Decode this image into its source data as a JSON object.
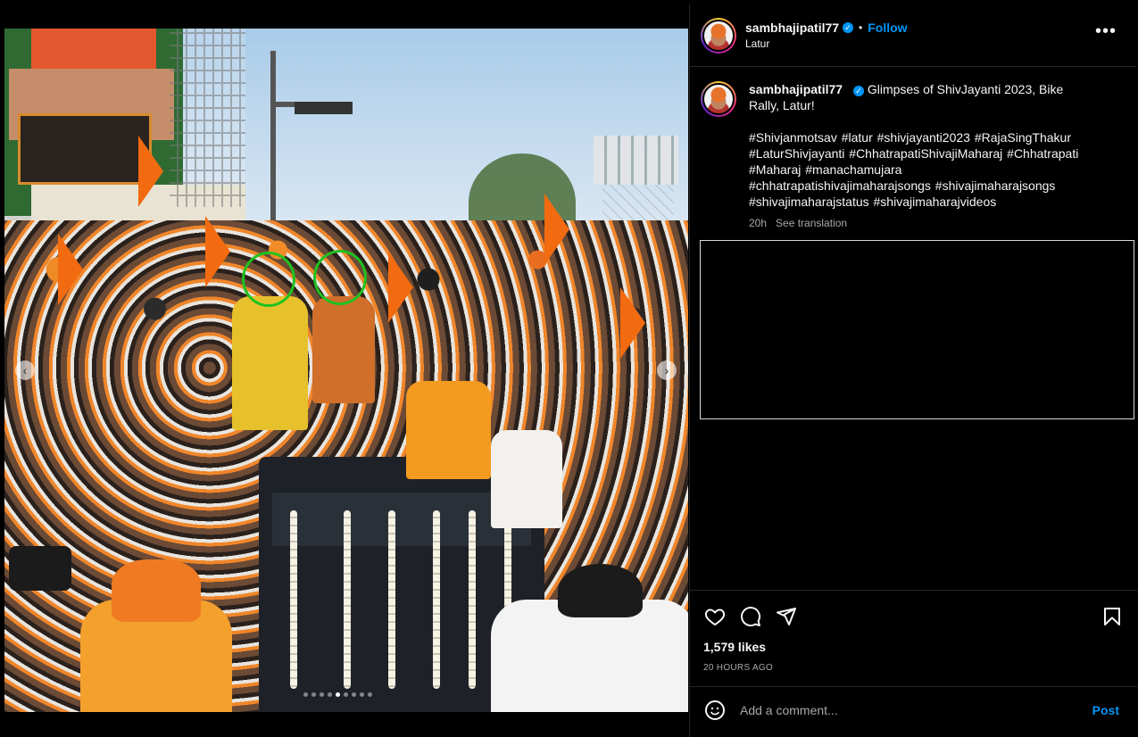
{
  "post": {
    "username": "sambhajipatil77",
    "verified_icon": "verified-badge-icon",
    "follow_label": "Follow",
    "separator": "•",
    "location": "Latur",
    "more_icon": "more-options-icon",
    "more_label": "•••"
  },
  "caption": {
    "username": "sambhajipatil77",
    "text": "Glimpses of ShivJayanti 2023, Bike Rally, Latur!",
    "hashtags": "#Shivjanmotsav #latur #shivjayanti2023 #RajaSingThakur #LaturShivjayanti #ChhatrapatiShivajiMaharaj #Chhatrapati #Maharaj #manachamujara #chhatrapatishivajimaharajsongs #shivajimaharajsongs #shivajimaharajstatus #shivajimaharajvideos",
    "age": "20h",
    "see_translation": "See translation"
  },
  "carousel": {
    "prev_label": "‹",
    "next_label": "›",
    "slide_count": 9,
    "active_slide": 5
  },
  "actions": {
    "icons": [
      "heart-icon",
      "comment-icon",
      "share-icon",
      "bookmark-icon"
    ],
    "likes": "1,579 likes",
    "timestamp": "20 HOURS AGO"
  },
  "comment": {
    "placeholder": "Add a comment...",
    "post_label": "Post"
  },
  "colors": {
    "accent": "#0095f6",
    "highlight_circle": "#1fc21f"
  }
}
